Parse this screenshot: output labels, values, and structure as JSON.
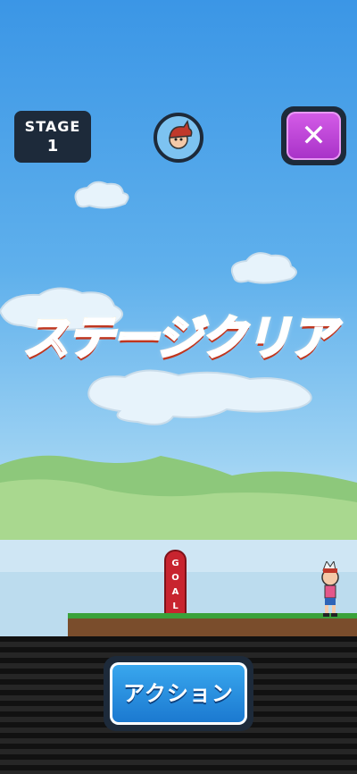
{
  "hud": {
    "stage_label": "STAGE",
    "stage_number": "1",
    "character_badge_icon": "character-icon",
    "close_button_icon": "close-icon",
    "close_glyph": "✕"
  },
  "banner": {
    "text": "ステージクリア"
  },
  "goal_flag": {
    "letters": [
      "G",
      "O",
      "A",
      "L"
    ]
  },
  "action_button": {
    "label": "アクション"
  },
  "colors": {
    "sky_top": "#3b96e6",
    "panel_dark": "#1d2a3a",
    "close_purple": "#b83fd2",
    "action_blue": "#2a90e0",
    "goal_red": "#c8242f",
    "grass": "#3aa23a",
    "dirt": "#7a4d2c",
    "banner_orange": "#f7a21a"
  }
}
